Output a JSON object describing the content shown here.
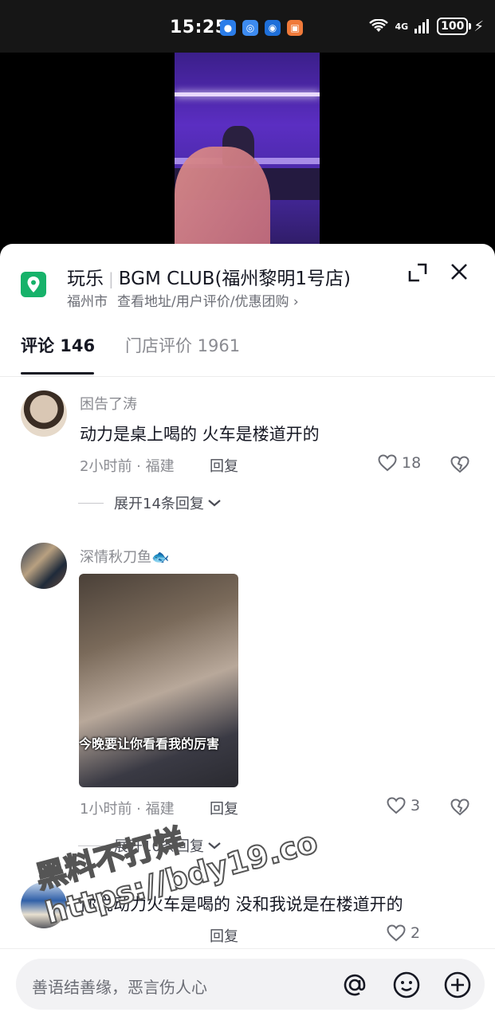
{
  "status_bar": {
    "time": "15:25",
    "network": "4G",
    "battery": "100"
  },
  "poi": {
    "category": "玩乐",
    "name": "BGM CLUB(福州黎明1号店)",
    "city": "福州市",
    "links": "查看地址/用户评价/优惠团购",
    "link_chevron": "›"
  },
  "tabs": [
    {
      "label": "评论 146",
      "active": true
    },
    {
      "label": "门店评价 1961",
      "active": false
    }
  ],
  "comments": [
    {
      "username": "困告了涛",
      "text": "动力是桌上喝的 火车是楼道开的",
      "meta": "2小时前 · 福建",
      "reply": "回复",
      "likes": "18",
      "expand": "展开14条回复"
    },
    {
      "username": "深情秋刀鱼🐟",
      "image_caption": "今晚要让你看看我的厉害",
      "meta": "1小时前 · 福建",
      "reply": "回复",
      "likes": "3",
      "expand": "展开10条回复"
    },
    {
      "username": "",
      "text": "你说动力火车是喝的 没和我说是在楼道开的",
      "meta": "",
      "reply": "回复",
      "likes": "2"
    }
  ],
  "watermark": {
    "line1": "黑料不打烊",
    "line2": "https://bdy19.co"
  },
  "input": {
    "placeholder": "善语结善缘，恶言伤人心"
  },
  "colors": {
    "poi_icon": "#17b26a",
    "text_primary": "#161823",
    "text_secondary": "#8a8b91"
  }
}
